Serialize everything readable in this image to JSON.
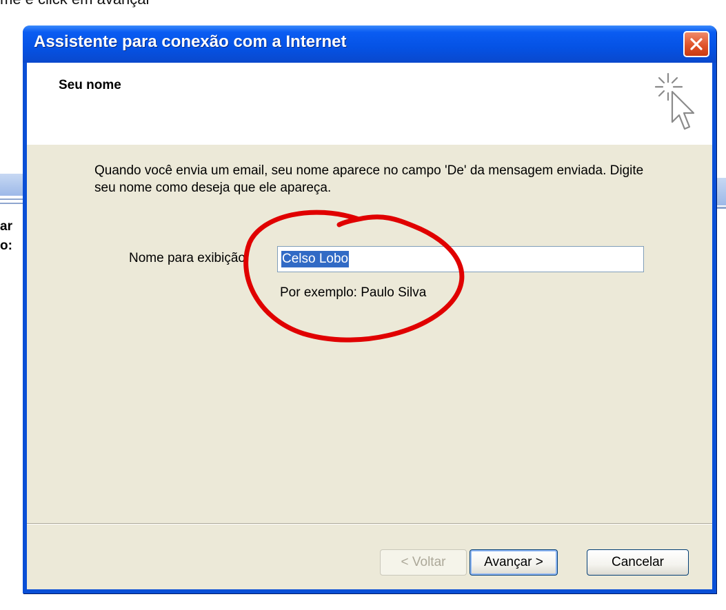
{
  "caption": "me e click em avançar",
  "background_window": {
    "label_1": "ar",
    "label_2": "o:"
  },
  "window": {
    "title": "Assistente para conexão com a Internet"
  },
  "header": {
    "title": "Seu nome",
    "icon": "wizard-cursor-sparkle-icon"
  },
  "body": {
    "description": "Quando você envia um email, seu nome aparece no campo 'De' da mensagem enviada. Digite seu nome como deseja que ele apareça.",
    "field_label": "Nome para exibição:",
    "field_value": "Celso Lobo",
    "example_hint": "Por exemplo: Paulo Silva"
  },
  "buttons": {
    "back": "< Voltar",
    "next": "Avançar >",
    "cancel": "Cancelar"
  },
  "colors": {
    "titlebar": "#0552e4",
    "client_background": "#ece9d8",
    "selection": "#316ac5",
    "highlight_circle": "#e00000",
    "close_button": "#e0532a"
  }
}
